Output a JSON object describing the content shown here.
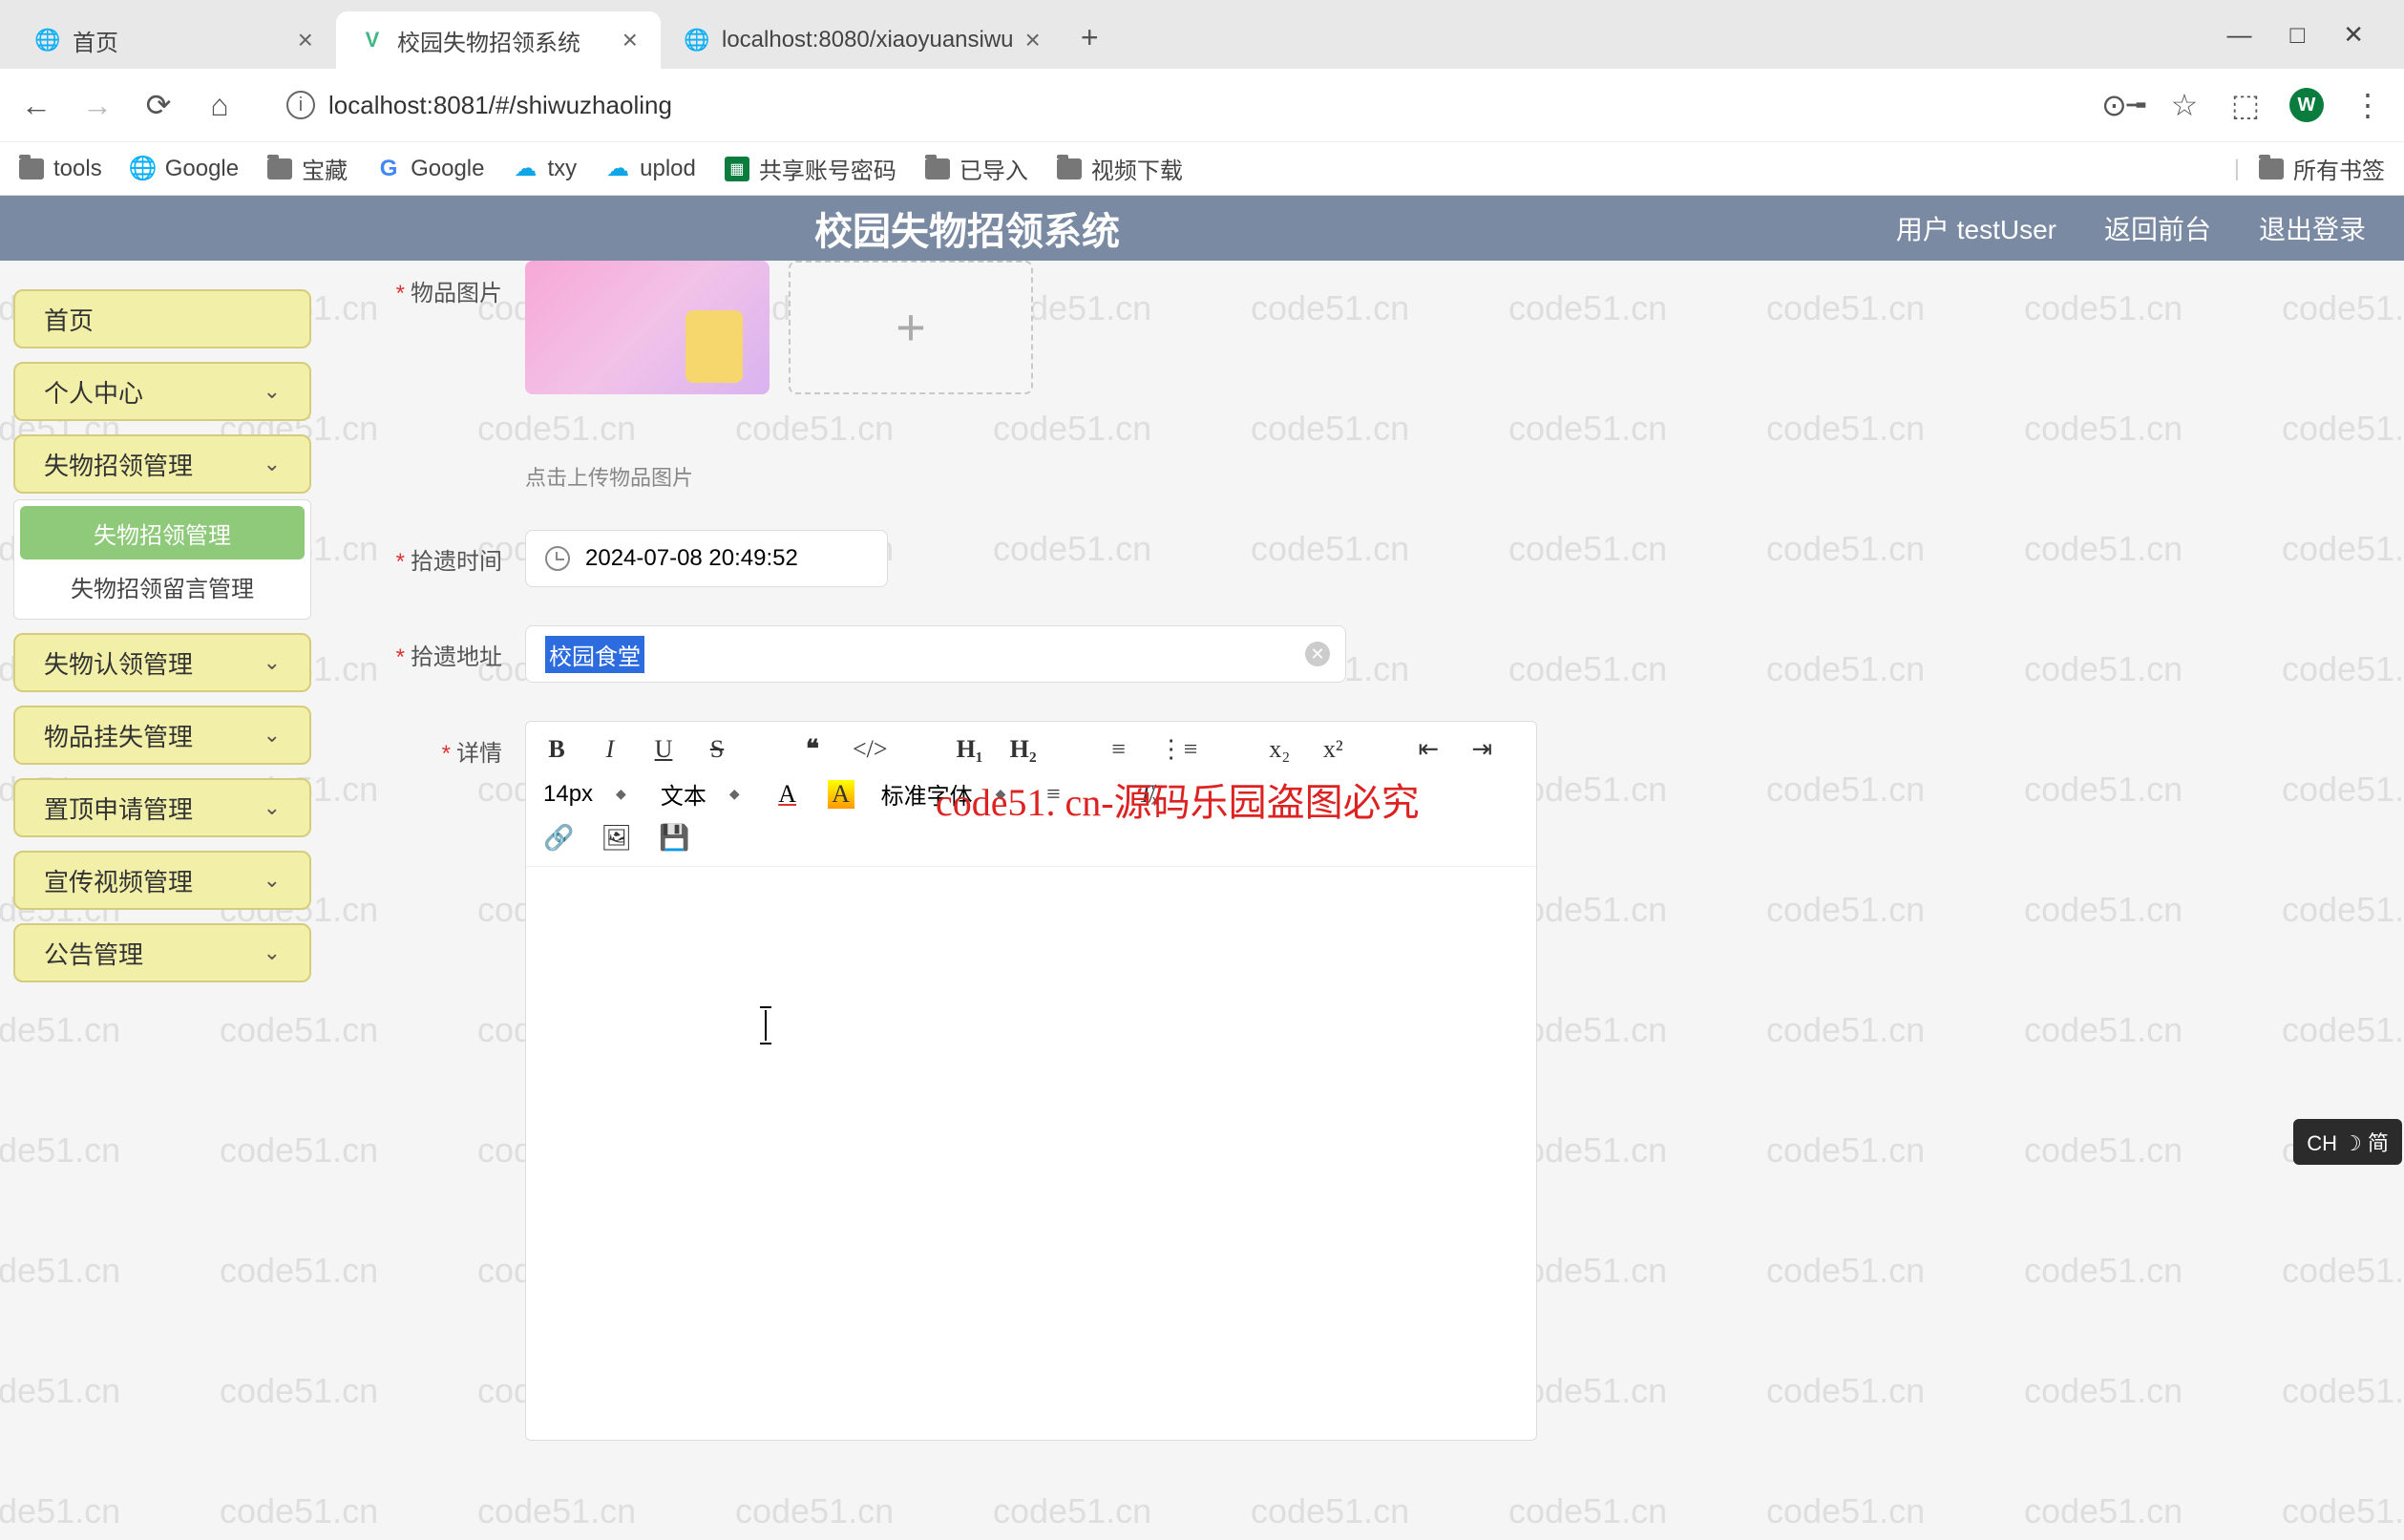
{
  "browser": {
    "tabs": [
      {
        "title": "首页",
        "favicon": "◉"
      },
      {
        "title": "校园失物招领系统",
        "favicon": "V"
      },
      {
        "title": "localhost:8080/xiaoyuansiwu",
        "favicon": "◌"
      }
    ],
    "url": "localhost:8081/#/shiwuzhaoling",
    "bookmarks": [
      "tools",
      "Google",
      "宝藏",
      "Google",
      "txy",
      "uplod",
      "共享账号密码",
      "已导入",
      "视频下载"
    ],
    "all_bookmarks": "所有书签",
    "avatar": "W"
  },
  "app": {
    "title": "校园失物招领系统",
    "user_prefix": "用户",
    "user": "testUser",
    "back": "返回前台",
    "logout": "退出登录"
  },
  "sidebar": {
    "home": "首页",
    "items": [
      "个人中心",
      "失物招领管理",
      "失物认领管理",
      "物品挂失管理",
      "置顶申请管理",
      "宣传视频管理",
      "公告管理"
    ],
    "sub_items": [
      "失物招领管理",
      "失物招领留言管理"
    ]
  },
  "form": {
    "img_label": "物品图片",
    "img_hint": "点击上传物品图片",
    "time_label": "拾遗时间",
    "time_value": "2024-07-08 20:49:52",
    "addr_label": "拾遗地址",
    "addr_value": "校园食堂",
    "detail_label": "详情"
  },
  "editor": {
    "size": "14px",
    "paragraph": "文本",
    "font": "标准字体"
  },
  "overlay": "code51. cn-源码乐园盗图必究",
  "ime": "CH ☽ 简",
  "watermark": "code51.cn"
}
